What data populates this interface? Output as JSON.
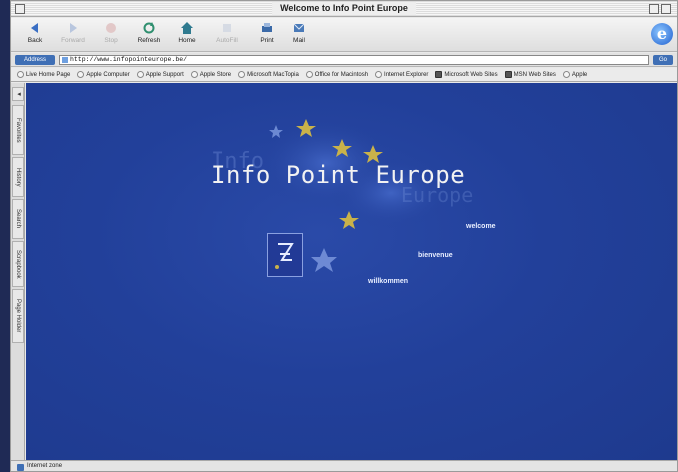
{
  "window": {
    "title": "Welcome to Info Point Europe"
  },
  "toolbar": {
    "buttons": [
      {
        "label": "Back",
        "icon": "back-arrow-icon",
        "enabled": true
      },
      {
        "label": "Forward",
        "icon": "forward-arrow-icon",
        "enabled": false
      },
      {
        "label": "Stop",
        "icon": "stop-icon",
        "enabled": false
      },
      {
        "label": "Refresh",
        "icon": "refresh-icon",
        "enabled": true
      },
      {
        "label": "Home",
        "icon": "home-icon",
        "enabled": true
      },
      {
        "label": "AutoFill",
        "icon": "autofill-icon",
        "enabled": false
      },
      {
        "label": "Print",
        "icon": "print-icon",
        "enabled": true
      },
      {
        "label": "Mail",
        "icon": "mail-icon",
        "enabled": true
      }
    ]
  },
  "address": {
    "label": "Address",
    "url": "http://www.infopointeurope.be/",
    "go_label": "Go"
  },
  "favorites": [
    {
      "label": "Live Home Page",
      "icon": "page-icon"
    },
    {
      "label": "Apple Computer",
      "icon": "page-icon"
    },
    {
      "label": "Apple Support",
      "icon": "page-icon"
    },
    {
      "label": "Apple Store",
      "icon": "page-icon"
    },
    {
      "label": "Microsoft MacTopia",
      "icon": "page-icon"
    },
    {
      "label": "Office for Macintosh",
      "icon": "page-icon"
    },
    {
      "label": "Internet Explorer",
      "icon": "page-icon"
    },
    {
      "label": "Microsoft Web Sites",
      "icon": "folder-icon"
    },
    {
      "label": "MSN Web Sites",
      "icon": "folder-icon"
    },
    {
      "label": "Apple",
      "icon": "page-icon"
    }
  ],
  "side_tabs": [
    "Favorites",
    "History",
    "Search",
    "Scrapbook",
    "Page Holder"
  ],
  "content": {
    "title": "Info Point Europe",
    "ghost_left": "Info",
    "ghost_right": "Europe",
    "languages": [
      "welcome",
      "bienvenue",
      "willkommen"
    ],
    "bg_color": "#22409a",
    "star_color": "#c9b24a"
  },
  "status": {
    "text": "Internet zone"
  }
}
